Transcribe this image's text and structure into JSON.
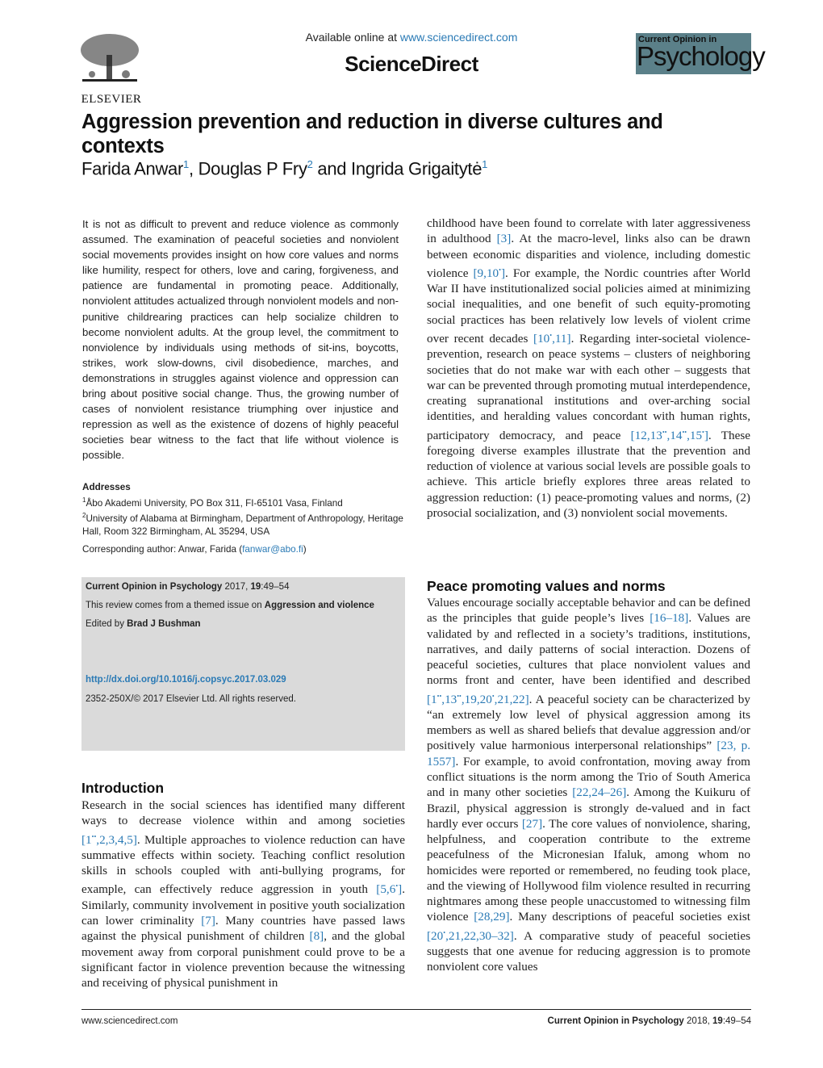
{
  "header": {
    "publisher_logo_text": "ELSEVIER",
    "available_prefix": "Available online at ",
    "available_link": "www.sciencedirect.com",
    "platform_title": "ScienceDirect",
    "journal_badge": {
      "line1": "Current Opinion in",
      "line2": "Psychology",
      "color": "#5b8089"
    }
  },
  "article": {
    "title": "Aggression prevention and reduction in diverse cultures and contexts",
    "authors": [
      {
        "name": "Farida Anwar",
        "aff": "1",
        "sep": ", "
      },
      {
        "name": "Douglas P Fry",
        "aff": "2",
        "sep": " and "
      },
      {
        "name": "Ingrida Grigaitytė",
        "aff": "1",
        "sep": ""
      }
    ]
  },
  "abstract": "It is not as difficult to prevent and reduce violence as commonly assumed. The examination of peaceful societies and nonviolent social movements provides insight on how core values and norms like humility, respect for others, love and caring, forgiveness, and patience are fundamental in promoting peace. Additionally, nonviolent attitudes actualized through nonviolent models and non-punitive childrearing practices can help socialize children to become nonviolent adults. At the group level, the commitment to nonviolence by individuals using methods of sit-ins, boycotts, strikes, work slow-downs, civil disobedience, marches, and demonstrations in struggles against violence and oppression can bring about positive social change. Thus, the growing number of cases of nonviolent resistance triumphing over injustice and repression as well as the existence of dozens of highly peaceful societies bear witness to the fact that life without violence is possible.",
  "addresses": {
    "heading": "Addresses",
    "items": [
      {
        "num": "1",
        "text": "Åbo Akademi University, PO Box 311, FI-65101 Vasa, Finland"
      },
      {
        "num": "2",
        "text": "University of Alabama at Birmingham, Department of Anthropology, Heritage Hall, Room 322 Birmingham, AL 35294, USA"
      }
    ],
    "corresponding_prefix": "Corresponding author: Anwar, Farida (",
    "corresponding_email": "fanwar@abo.fi",
    "corresponding_suffix": ")"
  },
  "info_box": {
    "journal": "Current Opinion in Psychology",
    "year": " 2017, ",
    "volume": "19",
    "pages": ":49–54",
    "themed_prefix": "This review comes from a themed issue on ",
    "themed_issue": "Aggression and violence",
    "edited_prefix": "Edited by ",
    "editor": "Brad J Bushman",
    "doi": "http://dx.doi.org/10.1016/j.copsyc.2017.03.029",
    "copyright": "2352-250X/© 2017 Elsevier Ltd. All rights reserved."
  },
  "sections": {
    "introduction": {
      "heading": "Introduction",
      "p1": "Research in the social sciences has identified many different ways to decrease violence within and among societies ",
      "c1": "[1••,2,3,4,5]",
      "p2": ". Multiple approaches to violence reduction can have summative effects within society. Teaching conflict resolution skills in schools coupled with anti-bullying programs, for example, can effectively reduce aggression in youth ",
      "c2": "[5,6•]",
      "p3": ". Similarly, community involvement in positive youth socialization can lower criminality ",
      "c3": "[7]",
      "p4": ". Many countries have passed laws against the physical punishment of children ",
      "c4": "[8]",
      "p5": ", and the global movement away from corporal punishment could prove to be a significant factor in violence prevention because the witnessing and receiving of physical punishment in"
    },
    "intro_continued": {
      "p1": "childhood have been found to correlate with later aggressiveness in adulthood ",
      "c1": "[3]",
      "p2": ". At the macro-level, links also can be drawn between economic disparities and violence, including domestic violence ",
      "c2": "[9,10•]",
      "p3": ". For example, the Nordic countries after World War II have institutionalized social policies aimed at minimizing social inequalities, and one benefit of such equity-promoting social practices has been relatively low levels of violent crime over recent decades ",
      "c3": "[10•,11]",
      "p4": ". Regarding inter-societal violence-prevention, research on peace systems – clusters of neighboring societies that do not make war with each other – suggests that war can be prevented through promoting mutual interdependence, creating supranational institutions and over-arching social identities, and heralding values concordant with human rights, participatory democracy, and peace ",
      "c4": "[12,13••,14••,15•]",
      "p5": ". These foregoing diverse examples illustrate that the prevention and reduction of violence at various social levels are possible goals to achieve. This article briefly explores three areas related to aggression reduction: (1) peace-promoting values and norms, (2) prosocial socialization, and (3) nonviolent social movements."
    },
    "peace_values": {
      "heading": "Peace promoting values and norms",
      "p1": "Values encourage socially acceptable behavior and can be defined as the principles that guide people’s lives ",
      "c1": "[16–18]",
      "p2": ". Values are validated by and reflected in a society’s traditions, institutions, narratives, and daily patterns of social interaction. Dozens of peaceful societies, cultures that place nonviolent values and norms front and center, have been identified and described ",
      "c2": "[1••,13••,19,20•,21,22]",
      "p3": ". A peaceful society can be characterized by “an extremely low level of physical aggression among its members as well as shared beliefs that devalue aggression and/or positively value harmonious interpersonal relationships” ",
      "c3": "[23, p. 1557]",
      "p4": ". For example, to avoid confrontation, moving away from conflict situations is the norm among the Trio of South America and in many other societies ",
      "c4": "[22,24–26]",
      "p5": ". Among the Kuikuru of Brazil, physical aggression is strongly de-valued and in fact hardly ever occurs ",
      "c5": "[27]",
      "p6": ". The core values of nonviolence, sharing, helpfulness, and cooperation contribute to the extreme peacefulness of the Micronesian Ifaluk, among whom no homicides were reported or remembered, no feuding took place, and the viewing of Hollywood film violence resulted in recurring nightmares among these people unaccustomed to witnessing film violence ",
      "c6": "[28,29]",
      "p7": ". Many descriptions of peaceful societies exist ",
      "c7": "[20•,21,22,30–32]",
      "p8": ". A comparative study of peaceful societies suggests that one avenue for reducing aggression is to promote nonviolent core values"
    }
  },
  "footer": {
    "left": "www.sciencedirect.com",
    "journal": "Current Opinion in Psychology",
    "year": " 2018, ",
    "volume": "19",
    "pages": ":49–54"
  }
}
